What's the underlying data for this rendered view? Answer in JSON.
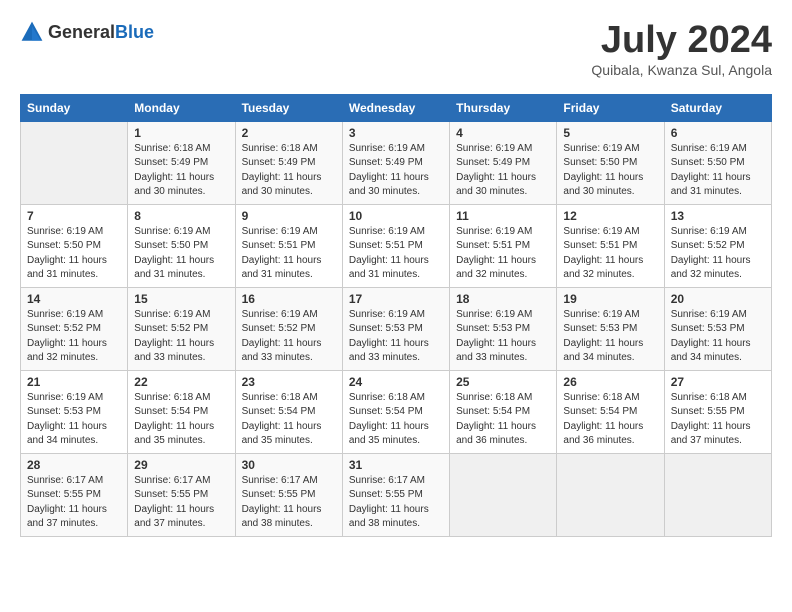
{
  "header": {
    "logo_general": "General",
    "logo_blue": "Blue",
    "title": "July 2024",
    "subtitle": "Quibala, Kwanza Sul, Angola"
  },
  "calendar": {
    "days_of_week": [
      "Sunday",
      "Monday",
      "Tuesday",
      "Wednesday",
      "Thursday",
      "Friday",
      "Saturday"
    ],
    "weeks": [
      [
        {
          "day": "",
          "info": ""
        },
        {
          "day": "1",
          "info": "Sunrise: 6:18 AM\nSunset: 5:49 PM\nDaylight: 11 hours\nand 30 minutes."
        },
        {
          "day": "2",
          "info": "Sunrise: 6:18 AM\nSunset: 5:49 PM\nDaylight: 11 hours\nand 30 minutes."
        },
        {
          "day": "3",
          "info": "Sunrise: 6:19 AM\nSunset: 5:49 PM\nDaylight: 11 hours\nand 30 minutes."
        },
        {
          "day": "4",
          "info": "Sunrise: 6:19 AM\nSunset: 5:49 PM\nDaylight: 11 hours\nand 30 minutes."
        },
        {
          "day": "5",
          "info": "Sunrise: 6:19 AM\nSunset: 5:50 PM\nDaylight: 11 hours\nand 30 minutes."
        },
        {
          "day": "6",
          "info": "Sunrise: 6:19 AM\nSunset: 5:50 PM\nDaylight: 11 hours\nand 31 minutes."
        }
      ],
      [
        {
          "day": "7",
          "info": "Sunrise: 6:19 AM\nSunset: 5:50 PM\nDaylight: 11 hours\nand 31 minutes."
        },
        {
          "day": "8",
          "info": "Sunrise: 6:19 AM\nSunset: 5:50 PM\nDaylight: 11 hours\nand 31 minutes."
        },
        {
          "day": "9",
          "info": "Sunrise: 6:19 AM\nSunset: 5:51 PM\nDaylight: 11 hours\nand 31 minutes."
        },
        {
          "day": "10",
          "info": "Sunrise: 6:19 AM\nSunset: 5:51 PM\nDaylight: 11 hours\nand 31 minutes."
        },
        {
          "day": "11",
          "info": "Sunrise: 6:19 AM\nSunset: 5:51 PM\nDaylight: 11 hours\nand 32 minutes."
        },
        {
          "day": "12",
          "info": "Sunrise: 6:19 AM\nSunset: 5:51 PM\nDaylight: 11 hours\nand 32 minutes."
        },
        {
          "day": "13",
          "info": "Sunrise: 6:19 AM\nSunset: 5:52 PM\nDaylight: 11 hours\nand 32 minutes."
        }
      ],
      [
        {
          "day": "14",
          "info": "Sunrise: 6:19 AM\nSunset: 5:52 PM\nDaylight: 11 hours\nand 32 minutes."
        },
        {
          "day": "15",
          "info": "Sunrise: 6:19 AM\nSunset: 5:52 PM\nDaylight: 11 hours\nand 33 minutes."
        },
        {
          "day": "16",
          "info": "Sunrise: 6:19 AM\nSunset: 5:52 PM\nDaylight: 11 hours\nand 33 minutes."
        },
        {
          "day": "17",
          "info": "Sunrise: 6:19 AM\nSunset: 5:53 PM\nDaylight: 11 hours\nand 33 minutes."
        },
        {
          "day": "18",
          "info": "Sunrise: 6:19 AM\nSunset: 5:53 PM\nDaylight: 11 hours\nand 33 minutes."
        },
        {
          "day": "19",
          "info": "Sunrise: 6:19 AM\nSunset: 5:53 PM\nDaylight: 11 hours\nand 34 minutes."
        },
        {
          "day": "20",
          "info": "Sunrise: 6:19 AM\nSunset: 5:53 PM\nDaylight: 11 hours\nand 34 minutes."
        }
      ],
      [
        {
          "day": "21",
          "info": "Sunrise: 6:19 AM\nSunset: 5:53 PM\nDaylight: 11 hours\nand 34 minutes."
        },
        {
          "day": "22",
          "info": "Sunrise: 6:18 AM\nSunset: 5:54 PM\nDaylight: 11 hours\nand 35 minutes."
        },
        {
          "day": "23",
          "info": "Sunrise: 6:18 AM\nSunset: 5:54 PM\nDaylight: 11 hours\nand 35 minutes."
        },
        {
          "day": "24",
          "info": "Sunrise: 6:18 AM\nSunset: 5:54 PM\nDaylight: 11 hours\nand 35 minutes."
        },
        {
          "day": "25",
          "info": "Sunrise: 6:18 AM\nSunset: 5:54 PM\nDaylight: 11 hours\nand 36 minutes."
        },
        {
          "day": "26",
          "info": "Sunrise: 6:18 AM\nSunset: 5:54 PM\nDaylight: 11 hours\nand 36 minutes."
        },
        {
          "day": "27",
          "info": "Sunrise: 6:18 AM\nSunset: 5:55 PM\nDaylight: 11 hours\nand 37 minutes."
        }
      ],
      [
        {
          "day": "28",
          "info": "Sunrise: 6:17 AM\nSunset: 5:55 PM\nDaylight: 11 hours\nand 37 minutes."
        },
        {
          "day": "29",
          "info": "Sunrise: 6:17 AM\nSunset: 5:55 PM\nDaylight: 11 hours\nand 37 minutes."
        },
        {
          "day": "30",
          "info": "Sunrise: 6:17 AM\nSunset: 5:55 PM\nDaylight: 11 hours\nand 38 minutes."
        },
        {
          "day": "31",
          "info": "Sunrise: 6:17 AM\nSunset: 5:55 PM\nDaylight: 11 hours\nand 38 minutes."
        },
        {
          "day": "",
          "info": ""
        },
        {
          "day": "",
          "info": ""
        },
        {
          "day": "",
          "info": ""
        }
      ]
    ]
  }
}
